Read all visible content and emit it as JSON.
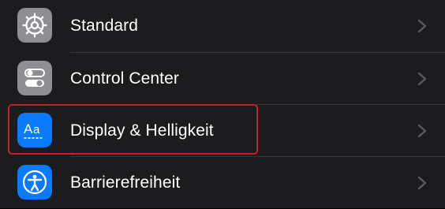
{
  "settings": {
    "items": [
      {
        "label": "Standard",
        "icon": "gear-icon",
        "icon_bg": "#8e8e93"
      },
      {
        "label": "Control Center",
        "icon": "toggles-icon",
        "icon_bg": "#8e8e93"
      },
      {
        "label": "Display & Helligkeit",
        "icon": "text-size-icon",
        "icon_bg": "#0a7aff"
      },
      {
        "label": "Barrierefreiheit",
        "icon": "accessibility-icon",
        "icon_bg": "#0a7aff"
      }
    ]
  },
  "colors": {
    "background": "#1c1c1e",
    "separator": "#38383a",
    "chevron": "#5a5a5e",
    "highlight_border": "#c4202b"
  }
}
